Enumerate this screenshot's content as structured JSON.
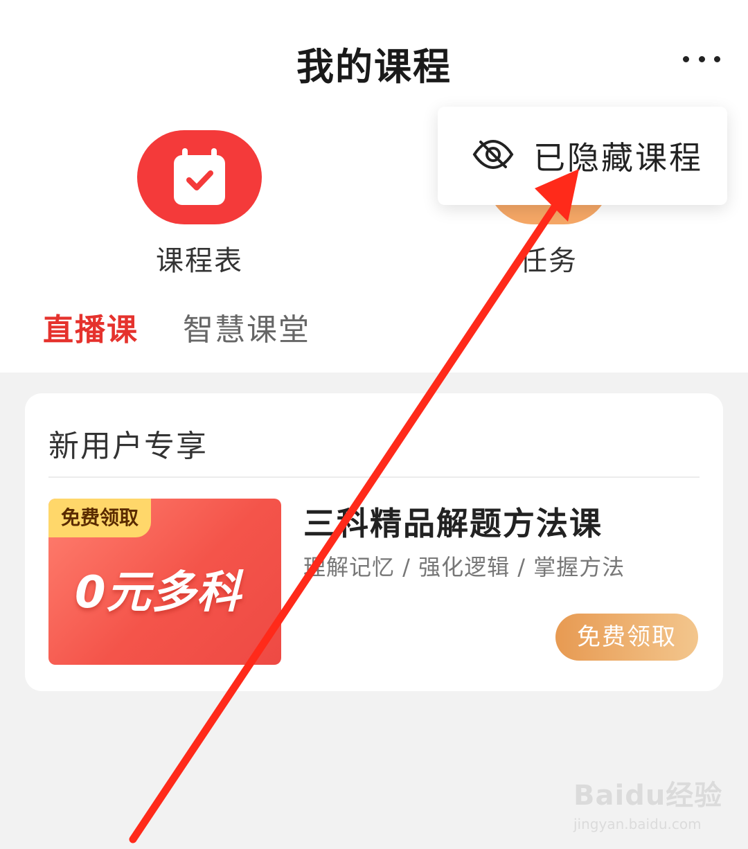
{
  "header": {
    "title": "我的课程"
  },
  "entries": {
    "schedule_label": "课程表",
    "task_label": "任务"
  },
  "dropdown": {
    "hidden_courses_label": "已隐藏课程"
  },
  "tabs": [
    {
      "label": "直播课",
      "active": true
    },
    {
      "label": "智慧课堂",
      "active": false
    }
  ],
  "promo_card": {
    "section_title": "新用户专享",
    "image_tag": "免费领取",
    "image_text": "0元多科",
    "course_title": "三科精品解题方法课",
    "course_subtitle": "理解记忆 / 强化逻辑 / 掌握方法",
    "button_label": "免费领取"
  },
  "watermark": {
    "logo": "Baidu经验",
    "url": "jingyan.baidu.com"
  },
  "colors": {
    "accent_red": "#e5322d",
    "schedule_icon_bg": "#f43a3a",
    "task_icon_bg": "#f5a766",
    "annotation_arrow": "#ff2a1a",
    "claim_button": "#e79a52"
  }
}
